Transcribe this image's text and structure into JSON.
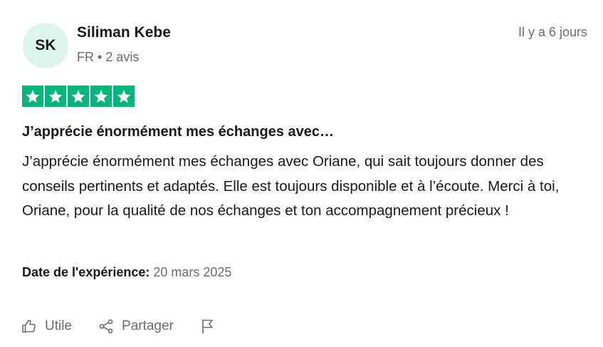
{
  "reviewer": {
    "initials": "SK",
    "name": "Siliman Kebe",
    "meta": "FR • 2 avis"
  },
  "review": {
    "date_ago": "Il y a 6 jours",
    "rating": 5,
    "title": "J’apprécie énormément mes échanges avec…",
    "body": "J’apprécie énormément mes échanges avec Oriane, qui sait toujours donner des conseils pertinents et adaptés. Elle est toujours disponible et à l’écoute. Merci à toi, Oriane, pour la qualité de nos échanges et ton accompagnement précieux !",
    "experience_label": "Date de l'expérience:",
    "experience_date": "20 mars 2025"
  },
  "actions": {
    "useful_label": "Utile",
    "share_label": "Partager"
  },
  "colors": {
    "star_green": "#00b67a",
    "avatar_bg": "#dcf5eb",
    "muted_text": "#6b6b6b",
    "text": "#191919"
  },
  "icons": {
    "star": "star-icon",
    "useful": "thumbs-up-icon",
    "share": "share-icon",
    "report": "flag-icon"
  }
}
